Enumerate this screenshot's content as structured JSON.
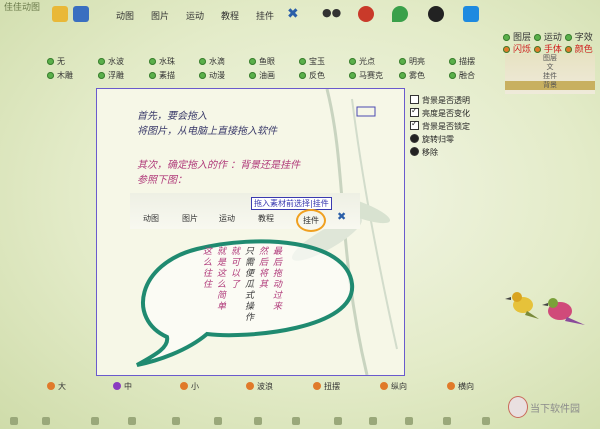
{
  "app_title": "佳佳动图",
  "menu": [
    "动图",
    "图片",
    "运动",
    "教程",
    "挂件"
  ],
  "effects_row1": [
    "无",
    "水波",
    "水珠",
    "水滴",
    "鱼眼",
    "宝玉",
    "光点",
    "明亮",
    "描摆"
  ],
  "effects_row2": [
    "木雕",
    "浮雕",
    "素描",
    "动漫",
    "油画",
    "反色",
    "马赛克",
    "雾色",
    "融合"
  ],
  "canvas": {
    "line1": "首先，要会拖入",
    "line2": "将图片，从电脑上直接拖入软件",
    "line3": "其次，确定拖入的作    ：背景还是挂件",
    "line4": "参照下图：",
    "inner_tag": "拖入素材前选择|挂件",
    "inner_menu": [
      "动图",
      "图片",
      "运动",
      "教程",
      "挂件"
    ],
    "bubble_col1": "这么往住",
    "bubble_col2": "就是这么简单",
    "bubble_col3": "就可以了",
    "bubble_col4": "只需便瓜式操作",
    "bubble_col5": "然后将其",
    "bubble_col6": "最后拖动过来"
  },
  "checks": [
    {
      "label": "背景是否透明",
      "on": false
    },
    {
      "label": "亮度是否变化",
      "on": true
    },
    {
      "label": "背景是否锁定",
      "on": true
    },
    {
      "label": "旋转归零",
      "on": false
    },
    {
      "label": "移除",
      "on": false
    }
  ],
  "right_panel": {
    "row1": [
      "图层",
      "运动",
      "字效"
    ],
    "row2": [
      "闪烁",
      "手体",
      "颜色"
    ],
    "list": [
      "图层",
      "文",
      "挂件",
      "背景"
    ]
  },
  "bottom_options": [
    "大",
    "中",
    "小",
    "波浪",
    "扭摆",
    "纵向",
    "横向"
  ],
  "watermark": "当下软件园"
}
